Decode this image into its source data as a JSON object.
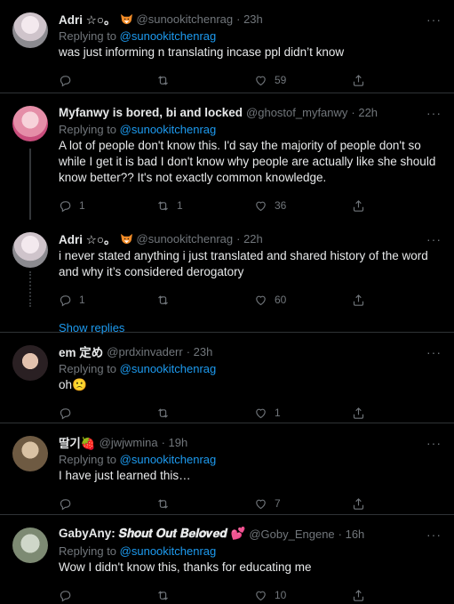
{
  "tweets": [
    {
      "name": "Adri ☆○。",
      "handle": "@sunookitchenrag",
      "time": "· 23h",
      "reply_prefix": "Replying to ",
      "reply_to": "@sunookitchenrag",
      "text": "was just informing n translating incase ppl didn’t know",
      "like_count": "59",
      "reply_count": "",
      "retweet_count": ""
    },
    {
      "name": "Myfanwy is bored, bi and locked",
      "handle": "@ghostof_myfanwy",
      "time": "· 22h",
      "reply_prefix": "Replying to ",
      "reply_to": "@sunookitchenrag",
      "text": "A lot of people don't know this. I'd say the majority of people don't so while I get it is bad I don't know why people are actually like she should know better?? It's not exactly common knowledge.",
      "reply_count": "1",
      "retweet_count": "1",
      "like_count": "36"
    },
    {
      "name": "Adri ☆○。",
      "handle": "@sunookitchenrag",
      "time": "· 22h",
      "text": "i never stated anything i just translated and  shared history of the word and why it’s considered derogatory",
      "reply_count": "1",
      "retweet_count": "",
      "like_count": "60"
    },
    {
      "name": "em 定め",
      "handle": "@prdxinvaderr",
      "time": "· 23h",
      "reply_prefix": "Replying to ",
      "reply_to": "@sunookitchenrag",
      "text": "oh🙁",
      "reply_count": "",
      "retweet_count": "",
      "like_count": "1"
    },
    {
      "name": "딸기🍓",
      "handle": "@jwjwmina",
      "time": "· 19h",
      "reply_prefix": "Replying to ",
      "reply_to": "@sunookitchenrag",
      "text": "I have just learned this…",
      "reply_count": "",
      "retweet_count": "",
      "like_count": "7"
    },
    {
      "name": "GabyAny: 𝑺𝒉𝒐𝒖𝒕 𝑶𝒖𝒕 𝑩𝒆𝒍𝒐𝒗𝒆𝒅 💕",
      "handle": "@Goby_Engene",
      "time": "· 16h",
      "reply_prefix": "Replying to ",
      "reply_to": "@sunookitchenrag",
      "text": "Wow I didn't know this, thanks for educating me",
      "reply_count": "",
      "retweet_count": "",
      "like_count": "10"
    }
  ],
  "show_replies": "Show replies",
  "more_icon": "···",
  "colors": {
    "accent": "#1d9bf0",
    "muted": "#71767b",
    "bg": "#000000"
  }
}
